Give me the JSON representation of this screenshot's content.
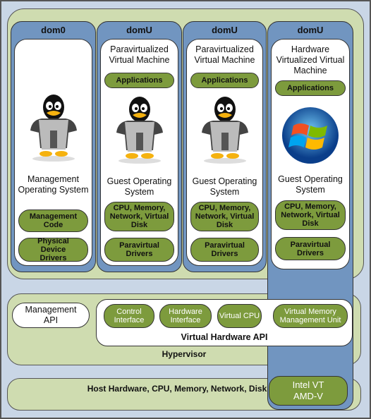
{
  "domains": [
    {
      "header": "dom0",
      "title": "",
      "apps": "",
      "os": "Management Operating System",
      "pills": [
        "Management Code",
        "Physical Device Drivers"
      ],
      "image": "tux-penguin-icon"
    },
    {
      "header": "domU",
      "title": "Paravirtualized Virtual Machine",
      "apps": "Applications",
      "os": "Guest Operating System",
      "pills": [
        "CPU, Memory, Network, Virtual Disk",
        "Paravirtual Drivers"
      ],
      "image": "tux-penguin-icon"
    },
    {
      "header": "domU",
      "title": "Paravirtualized Virtual Machine",
      "apps": "Applications",
      "os": "Guest Operating System",
      "pills": [
        "CPU, Memory, Network, Virtual Disk",
        "Paravirtual Drivers"
      ],
      "image": "tux-penguin-icon"
    },
    {
      "header": "domU",
      "title": "Hardware Virtualized Virtual Machine",
      "apps": "Applications",
      "os": "Guest Operating System",
      "pills": [
        "CPU, Memory, Network, Virtual Disk",
        "Paravirtual Drivers"
      ],
      "image": "windows-logo-icon"
    }
  ],
  "hypervisor": {
    "label": "Hypervisor",
    "management_api": "Management API",
    "virtual_hw_api": "Virtual Hardware API",
    "components": [
      "Control Interface",
      "Hardware Interface",
      "Virtual CPU",
      "Virtual Memory Management Unit"
    ]
  },
  "host": {
    "label": "Host Hardware, CPU, Memory, Network, Disk",
    "hw_virt": "Intel VT AMD-V"
  },
  "colors": {
    "background": "#c9d6e6",
    "green_panel": "#cfdcb0",
    "domain_column": "#7195c0",
    "pill": "#7d9b3d"
  }
}
